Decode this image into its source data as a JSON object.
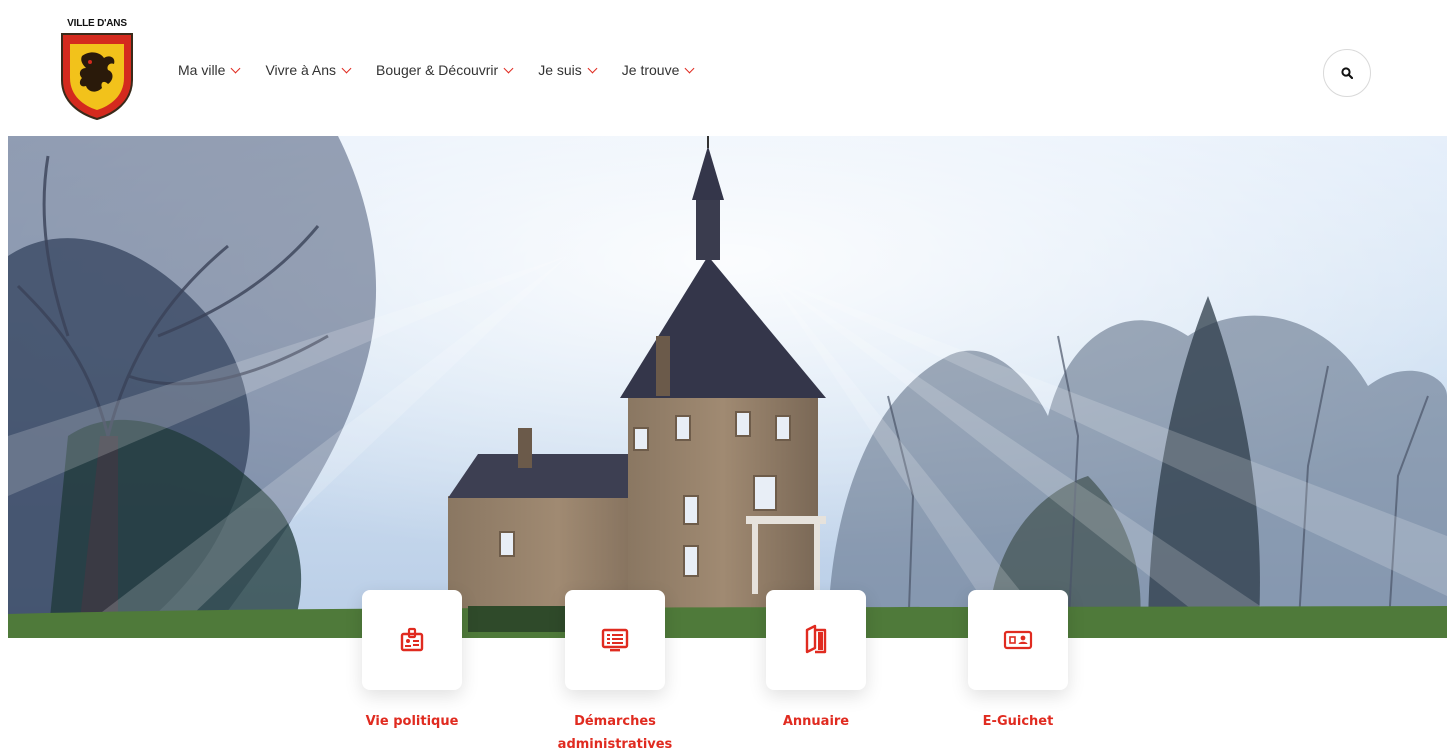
{
  "logo": {
    "text": "VILLE D'ANS"
  },
  "nav": [
    {
      "label": "Ma ville"
    },
    {
      "label": "Vivre à Ans"
    },
    {
      "label": "Bouger & Découvrir"
    },
    {
      "label": "Je suis"
    },
    {
      "label": "Je trouve"
    }
  ],
  "quick_links": [
    {
      "label": "Vie politique",
      "icon": "id-badge-icon"
    },
    {
      "label": "Démarches administratives",
      "icon": "list-screen-icon"
    },
    {
      "label": "Annuaire",
      "icon": "open-book-icon"
    },
    {
      "label": "E-Guichet",
      "icon": "id-card-icon"
    }
  ],
  "colors": {
    "accent": "#e02b20",
    "text": "#333333"
  }
}
